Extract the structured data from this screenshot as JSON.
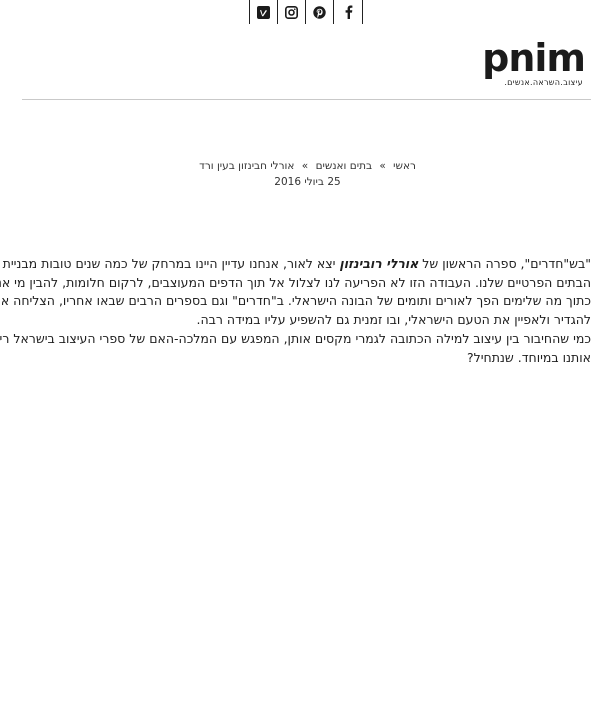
{
  "social": [
    {
      "icon": "vimeo-icon"
    },
    {
      "icon": "instagram-icon"
    },
    {
      "icon": "pinterest-icon"
    },
    {
      "icon": "facebook-icon"
    }
  ],
  "logo": {
    "word": "pnim",
    "tagline": "עיצוב.השראה.אנשים."
  },
  "breadcrumb": {
    "home": "ראשי",
    "category": "בתים ואנשים",
    "current": "אורלי חבינזון בעין ורד",
    "separator": "»"
  },
  "post_date": "25 ביולי 2016",
  "article": {
    "line1_before": "\"בש\"חדרים\", ספרה הראשון של ",
    "line1_bold": "אורלי רובינזון",
    "line1_after": " יצא לאור, אנחנו עדיין היינו במרחק של כמה שנים טובות מבניית",
    "line2": "הבתים הפרטיים שלנו. העבודה הזו לא הפריעה לנו לצלול אל תוך הדפים המעוצבים, לרקום חלומות, להבין מי אנחנו",
    "line3": "כתוך מה שלימים הפך לאורים ותומים של הבונה הישראלי. ב\"חדרים\" וגם בספרים הרבים שבאו אחריו, הצליחה אורלי",
    "line4": "להגדיר ולאפיין את הטעם הישראלי, ובו זמנית גם להשפיע עליו במידה רבה.",
    "line5": "כמי שהחיבור בין עיצוב למילה הכתובה לגמרי מקסים אותן, המפגש עם המלכה-האם של ספרי העיצוב בישראל ריגש",
    "line6": "אותנו במיוחד. שנתחיל?"
  }
}
